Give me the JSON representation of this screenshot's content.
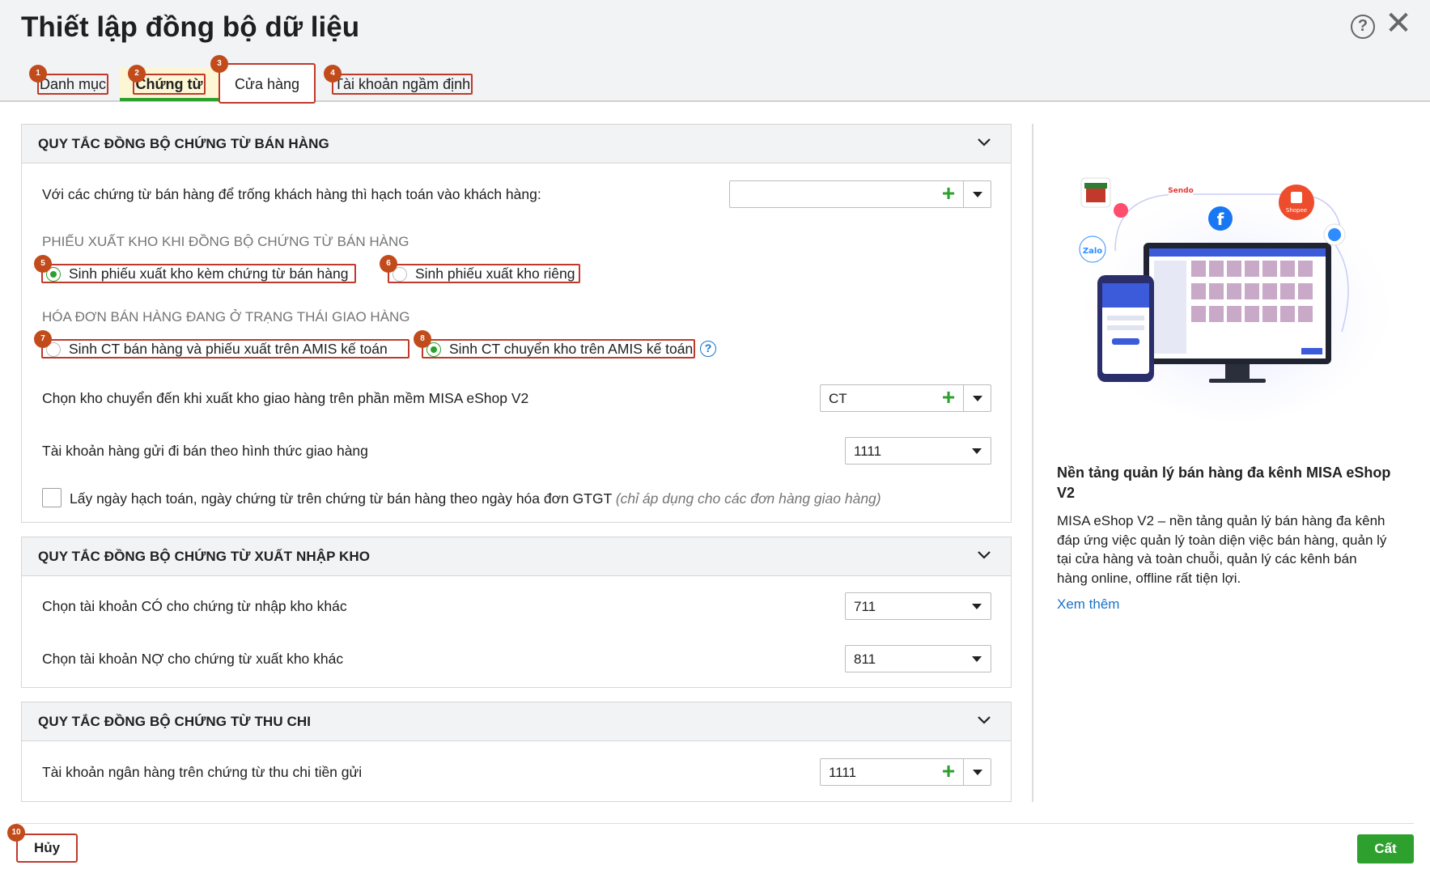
{
  "dialog": {
    "title": "Thiết lập đồng bộ dữ liệu",
    "help_symbol": "?",
    "close_symbol": "✕"
  },
  "tabs": [
    {
      "label": "Danh mục",
      "marker": "1"
    },
    {
      "label": "Chứng từ",
      "marker": "2",
      "active": true
    },
    {
      "label": "Cửa hàng",
      "marker": "3"
    },
    {
      "label": "Tài khoản ngầm định",
      "marker": "4"
    }
  ],
  "sales": {
    "title": "QUY TẮC ĐỒNG BỘ CHỨNG TỪ BÁN HÀNG",
    "empty_customer_label": "Với các chứng từ bán hàng để trống khách hàng thì hạch toán vào khách hàng:",
    "empty_customer_value": "",
    "export_heading": "PHIẾU XUẤT KHO KHI ĐỒNG BỘ CHỨNG TỪ BÁN HÀNG",
    "export_opt1": {
      "label": "Sinh phiếu xuất kho kèm chứng từ bán hàng",
      "marker": "5",
      "checked": true
    },
    "export_opt2": {
      "label": "Sinh phiếu xuất kho riêng",
      "marker": "6",
      "checked": false
    },
    "delivery_heading": "HÓA ĐƠN BÁN HÀNG ĐANG Ở TRẠNG THÁI GIAO HÀNG",
    "delivery_opt1": {
      "label": "Sinh CT bán hàng và phiếu xuất trên AMIS kế toán",
      "marker": "7",
      "checked": false
    },
    "delivery_opt2": {
      "label": "Sinh CT chuyển kho trên AMIS kế toán",
      "marker": "8",
      "checked": true
    },
    "help_symbol": "?",
    "warehouse_label": "Chọn kho chuyển đến khi xuất kho giao hàng trên phần mềm MISA eShop V2",
    "warehouse_value": "CT",
    "account_label": "Tài khoản hàng gửi đi bán theo hình thức giao hàng",
    "account_value": "1111",
    "date_checkbox_label": "Lấy ngày hạch toán, ngày chứng từ trên chứng từ bán hàng theo ngày hóa đơn GTGT",
    "date_checkbox_note": "(chỉ áp dụng cho các đơn hàng giao hàng)",
    "date_checkbox_checked": false
  },
  "inventory": {
    "title": "QUY TẮC ĐỒNG BỘ CHỨNG TỪ XUẤT NHẬP KHO",
    "credit_label": "Chọn tài khoản CÓ cho chứng từ nhập kho khác",
    "credit_value": "711",
    "debit_label": "Chọn tài khoản NỢ cho chứng từ xuất kho khác",
    "debit_value": "811"
  },
  "cash": {
    "title": "QUY TẮC ĐỒNG BỘ CHỨNG TỪ THU CHI",
    "bank_label": "Tài khoản ngân hàng trên chứng từ thu chi tiền gửi",
    "bank_value": "1111"
  },
  "promo": {
    "title": "Nền tảng quản lý bán hàng đa kênh MISA eShop V2",
    "description": "MISA eShop V2 – nền tảng quản lý bán hàng đa kênh đáp ứng việc quản lý toàn diện việc bán hàng, quản lý tại cửa hàng và toàn chuỗi, quản lý các kênh bán hàng online, offline rất tiện lợi.",
    "link": "Xem thêm",
    "logo_zalo": "Zalo",
    "logo_sendo": "Sendo",
    "logo_shopee": "Shopee",
    "logo_facebook": "f"
  },
  "footer": {
    "cancel_label": "Hủy",
    "cancel_marker": "10",
    "save_label": "Cất"
  },
  "colors": {
    "accent_green": "#2ea02e",
    "annotation_red": "#c0392b",
    "marker_orange": "#c24b1c",
    "link_blue": "#1a73c8"
  }
}
